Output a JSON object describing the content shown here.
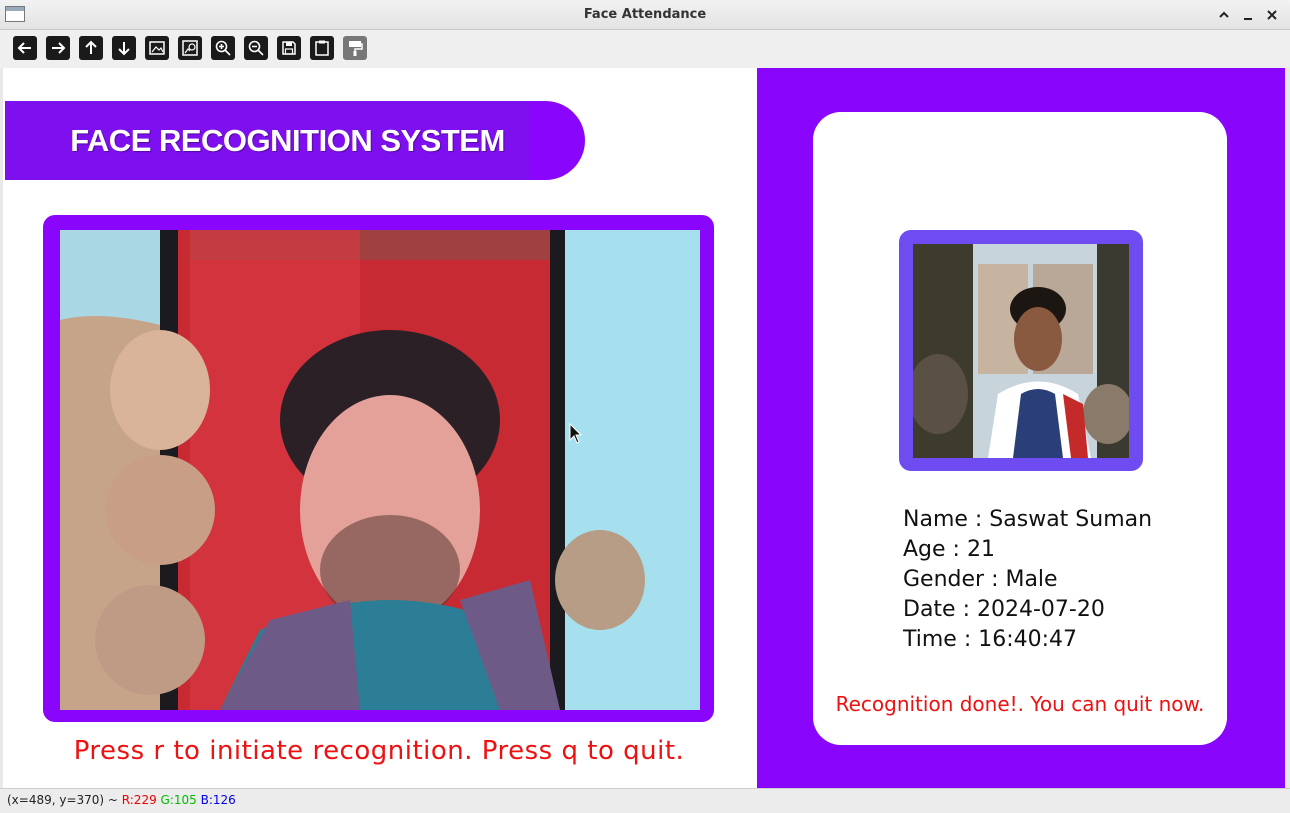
{
  "window": {
    "title": "Face Attendance"
  },
  "toolbar": {
    "buttons": [
      {
        "name": "pan-left-button",
        "icon": "arrow-left-icon"
      },
      {
        "name": "pan-right-button",
        "icon": "arrow-right-icon"
      },
      {
        "name": "pan-up-button",
        "icon": "arrow-up-icon"
      },
      {
        "name": "pan-down-button",
        "icon": "arrow-down-icon"
      },
      {
        "name": "zoom-image-button",
        "icon": "image-icon"
      },
      {
        "name": "zoom-fit-button",
        "icon": "image-zoom-icon"
      },
      {
        "name": "zoom-in-button",
        "icon": "zoom-in-icon"
      },
      {
        "name": "zoom-out-button",
        "icon": "zoom-out-icon"
      },
      {
        "name": "save-button",
        "icon": "save-icon"
      },
      {
        "name": "copy-clipboard-button",
        "icon": "clipboard-icon"
      },
      {
        "name": "properties-button",
        "icon": "paint-roller-icon"
      }
    ]
  },
  "app": {
    "header": "FACE RECOGNITION SYSTEM",
    "prompt": "Press r to initiate recognition. Press q to quit.",
    "student": {
      "name_line": "Name : Saswat Suman",
      "age_line": "Age : 21",
      "gender_line": "Gender : Male",
      "date_line": "Date : 2024-07-20",
      "time_line": "Time : 16:40:47"
    },
    "status_message": "Recognition done!. You can quit now."
  },
  "statusbar": {
    "coords": "(x=489, y=370) ~ ",
    "r": "R:229",
    "g": "G:105",
    "b": "B:126"
  },
  "colors": {
    "accent_purple": "#8a05fb",
    "photo_frame": "#6e4cf2",
    "alert_red": "#e11111"
  }
}
